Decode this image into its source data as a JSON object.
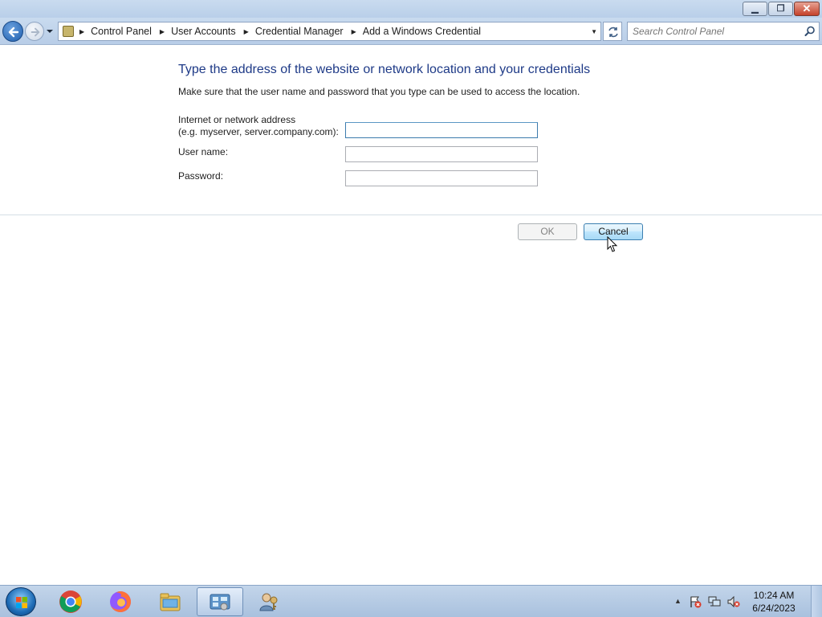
{
  "breadcrumb": {
    "items": [
      "Control Panel",
      "User Accounts",
      "Credential Manager",
      "Add a Windows Credential"
    ]
  },
  "search": {
    "placeholder": "Search Control Panel"
  },
  "form": {
    "heading": "Type the address of the website or network location and your credentials",
    "subtext": "Make sure that the user name and password that you type can be used to access the location.",
    "address_label_line1": "Internet or network address",
    "address_label_line2": "(e.g. myserver, server.company.com):",
    "address_value": "",
    "username_label": "User name:",
    "username_value": "",
    "password_label": "Password:",
    "password_value": ""
  },
  "buttons": {
    "ok_label": "OK",
    "cancel_label": "Cancel"
  },
  "taskbar": {
    "items": [
      "chrome-icon",
      "firefox-icon",
      "explorer-icon",
      "control-panel-icon",
      "credential-manager-icon"
    ],
    "active_item": "control-panel-icon",
    "clock_time": "10:24 AM",
    "clock_date": "6/24/2023"
  },
  "colors": {
    "heading": "#1e3a87",
    "accent": "#3c7fb1",
    "titlebar": "#c9dbef"
  }
}
